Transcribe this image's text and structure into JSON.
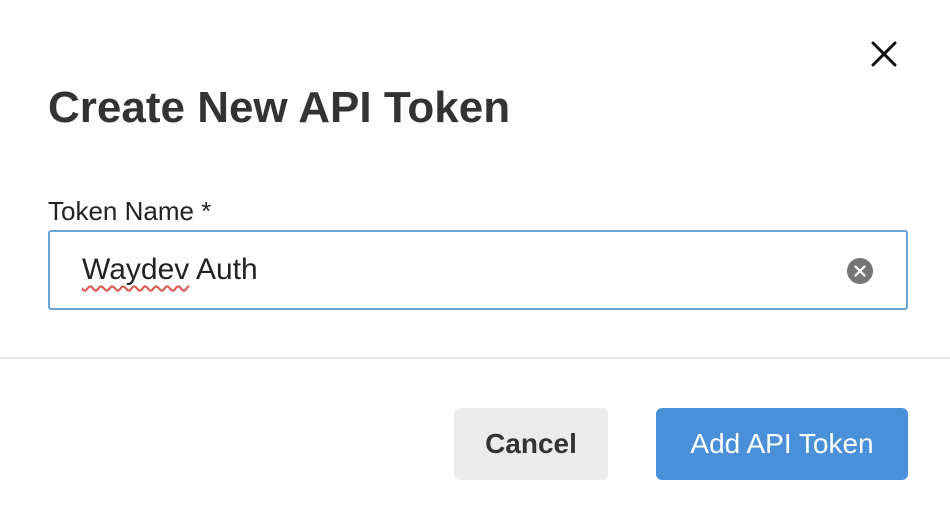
{
  "dialog": {
    "title": "Create New API Token",
    "close_icon": "close-icon"
  },
  "form": {
    "token_name": {
      "label": "Token Name *",
      "value_word1": "Waydev",
      "value_word2": " Auth",
      "clear_icon": "clear-circle-icon"
    }
  },
  "footer": {
    "cancel_label": "Cancel",
    "submit_label": "Add API Token"
  },
  "colors": {
    "primary": "#4a90d9",
    "input_border": "#6aa3d8",
    "cancel_bg": "#ebebeb",
    "spellcheck": "#e0554b"
  }
}
